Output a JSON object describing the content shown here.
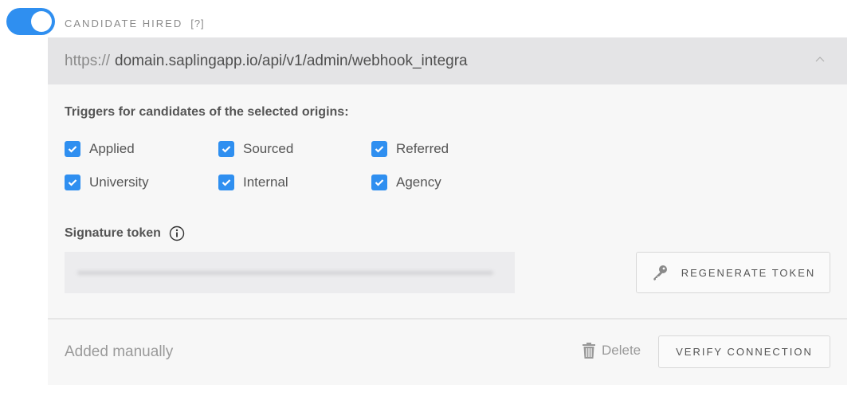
{
  "header": {
    "toggle_on": true,
    "title": "CANDIDATE HIRED",
    "help": "[?]"
  },
  "url": {
    "protocol": "https://",
    "host_path": "domain.saplingapp.io/api/v1/admin/webhook_integra",
    "chevron_icon": "chevron-up-icon"
  },
  "triggers": {
    "label": "Triggers for candidates of the selected origins:",
    "options": [
      {
        "label": "Applied",
        "checked": true
      },
      {
        "label": "Sourced",
        "checked": true
      },
      {
        "label": "Referred",
        "checked": true
      },
      {
        "label": "University",
        "checked": true
      },
      {
        "label": "Internal",
        "checked": true
      },
      {
        "label": "Agency",
        "checked": true
      }
    ]
  },
  "signature": {
    "label": "Signature token",
    "info_icon": "info-icon",
    "token_value": "(blurred)",
    "regenerate_label": "REGENERATE TOKEN",
    "regenerate_icon": "key-icon"
  },
  "footer": {
    "source": "Added manually",
    "delete_label": "Delete",
    "delete_icon": "trash-icon",
    "verify_label": "VERIFY CONNECTION"
  },
  "colors": {
    "accent": "#2f8ff0"
  }
}
